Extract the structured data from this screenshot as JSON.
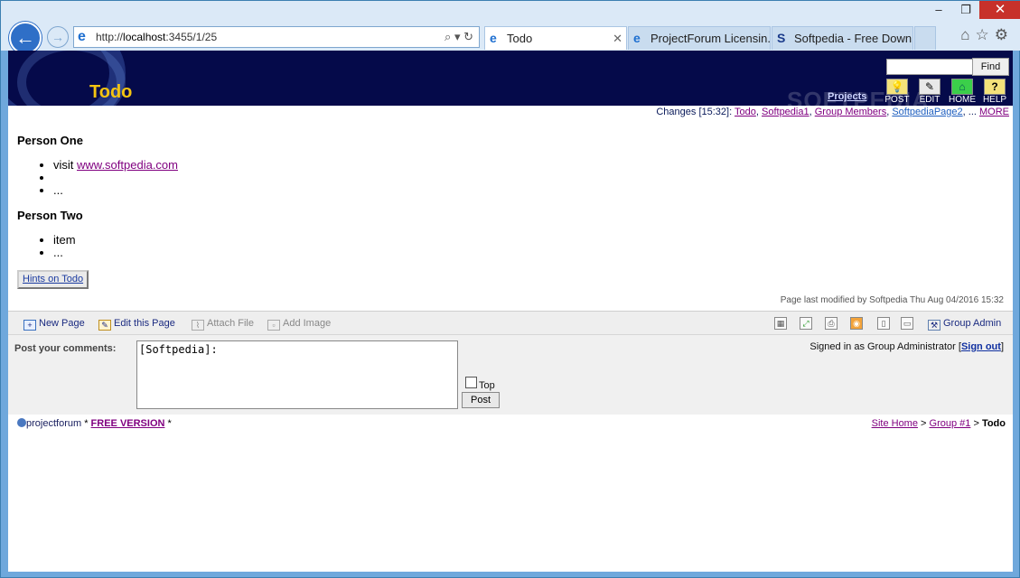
{
  "browser": {
    "address": {
      "prefix": "http://",
      "host": "localhost",
      "rest": ":3455/1/25"
    },
    "tabs": [
      {
        "label": "Todo",
        "active": true
      },
      {
        "label": "ProjectForum Licensin...",
        "active": false
      },
      {
        "label": "Softpedia - Free Downl...",
        "active": false
      }
    ],
    "window_controls": {
      "minimize": "–",
      "maximize": "❐",
      "close": "✕"
    }
  },
  "banner": {
    "title": "Todo",
    "find_label": "Find",
    "projects_link": "Projects",
    "watermark": "SOFTPEDIA",
    "buttons": [
      {
        "label": "POST",
        "icon": "lightbulb-icon",
        "glyph": "💡"
      },
      {
        "label": "EDIT",
        "icon": "edit-icon",
        "glyph": "✎"
      },
      {
        "label": "HOME",
        "icon": "home-icon",
        "glyph": "⌂"
      },
      {
        "label": "HELP",
        "icon": "help-icon",
        "glyph": "?"
      }
    ]
  },
  "changes": {
    "label": "Changes [15:32]:",
    "links": [
      "Todo",
      "Softpedia1",
      "Group Members",
      "SoftpediaPage2"
    ],
    "ellipsis": "...",
    "more": "MORE"
  },
  "content": {
    "sections": [
      {
        "heading": "Person One",
        "items": [
          {
            "text": "visit ",
            "link": "www.softpedia.com"
          },
          {
            "text": ""
          },
          {
            "text": "..."
          }
        ]
      },
      {
        "heading": "Person Two",
        "items": [
          {
            "text": "item"
          },
          {
            "text": "..."
          }
        ]
      }
    ],
    "hints_button": "Hints on Todo",
    "last_modified": "Page last modified by Softpedia Thu Aug 04/2016 15:32"
  },
  "toolbar": {
    "new_page": "New Page",
    "edit_page": "Edit this Page",
    "attach_file": "Attach File",
    "add_image": "Add Image",
    "group_admin": "Group Admin"
  },
  "comment": {
    "label": "Post your comments:",
    "textarea_value": "[Softpedia]:",
    "top_label": "Top",
    "post_button": "Post",
    "signed_in_prefix": "Signed in as Group Administrator [",
    "sign_out": "Sign out",
    "signed_in_suffix": "]"
  },
  "footer": {
    "brand": "projectforum",
    "sep": " * ",
    "free_version": "FREE VERSION",
    "tail": " *",
    "crumbs": [
      "Site Home",
      "Group #1"
    ],
    "crumb_sep": " > ",
    "current": "Todo"
  }
}
